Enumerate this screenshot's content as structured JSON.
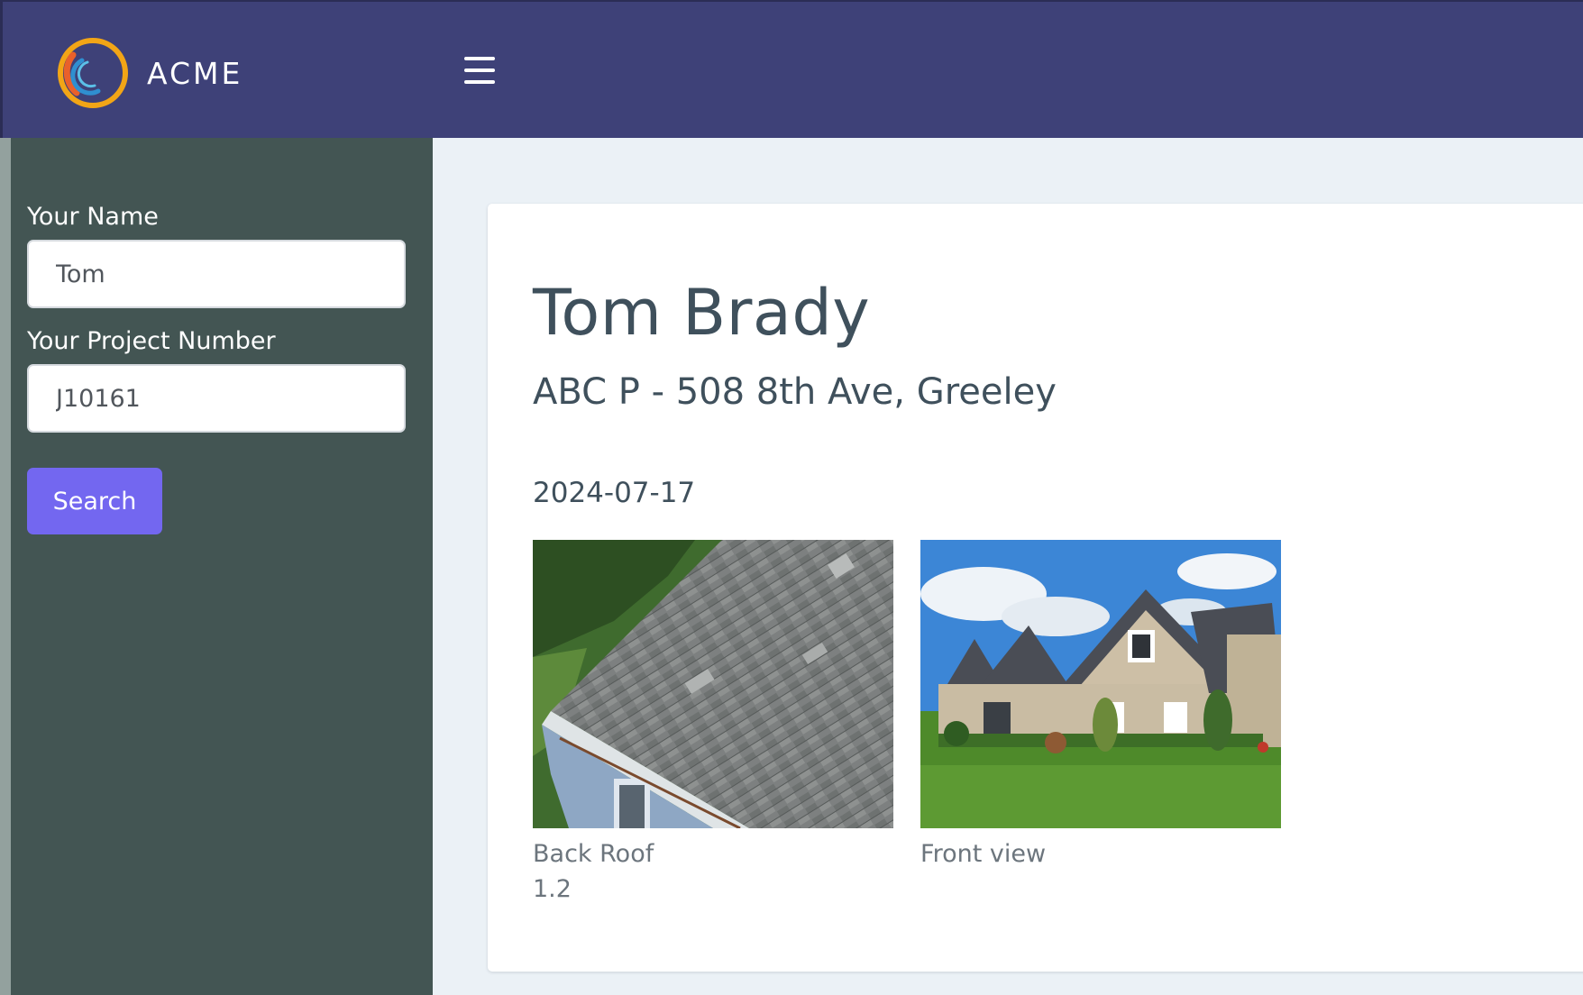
{
  "header": {
    "brand": "ACME",
    "logo_icon": "acme-logo-icon",
    "menu_icon": "hamburger-menu-icon",
    "color": "#3e4178"
  },
  "sidebar": {
    "name_label": "Your Name",
    "name_value": "Tom",
    "project_label": "Your Project Number",
    "project_value": "J10161",
    "search_label": "Search",
    "color": "#435553",
    "button_color": "#7367f0"
  },
  "main": {
    "client_name": "Tom Brady",
    "project_address": "ABC P - 508 8th Ave, Greeley",
    "date": "2024-07-17",
    "photos": [
      {
        "caption": "Back Roof",
        "value": "1.2",
        "image": "roof-shingles-photo"
      },
      {
        "caption": "Front view",
        "value": "",
        "image": "house-front-photo"
      }
    ]
  }
}
